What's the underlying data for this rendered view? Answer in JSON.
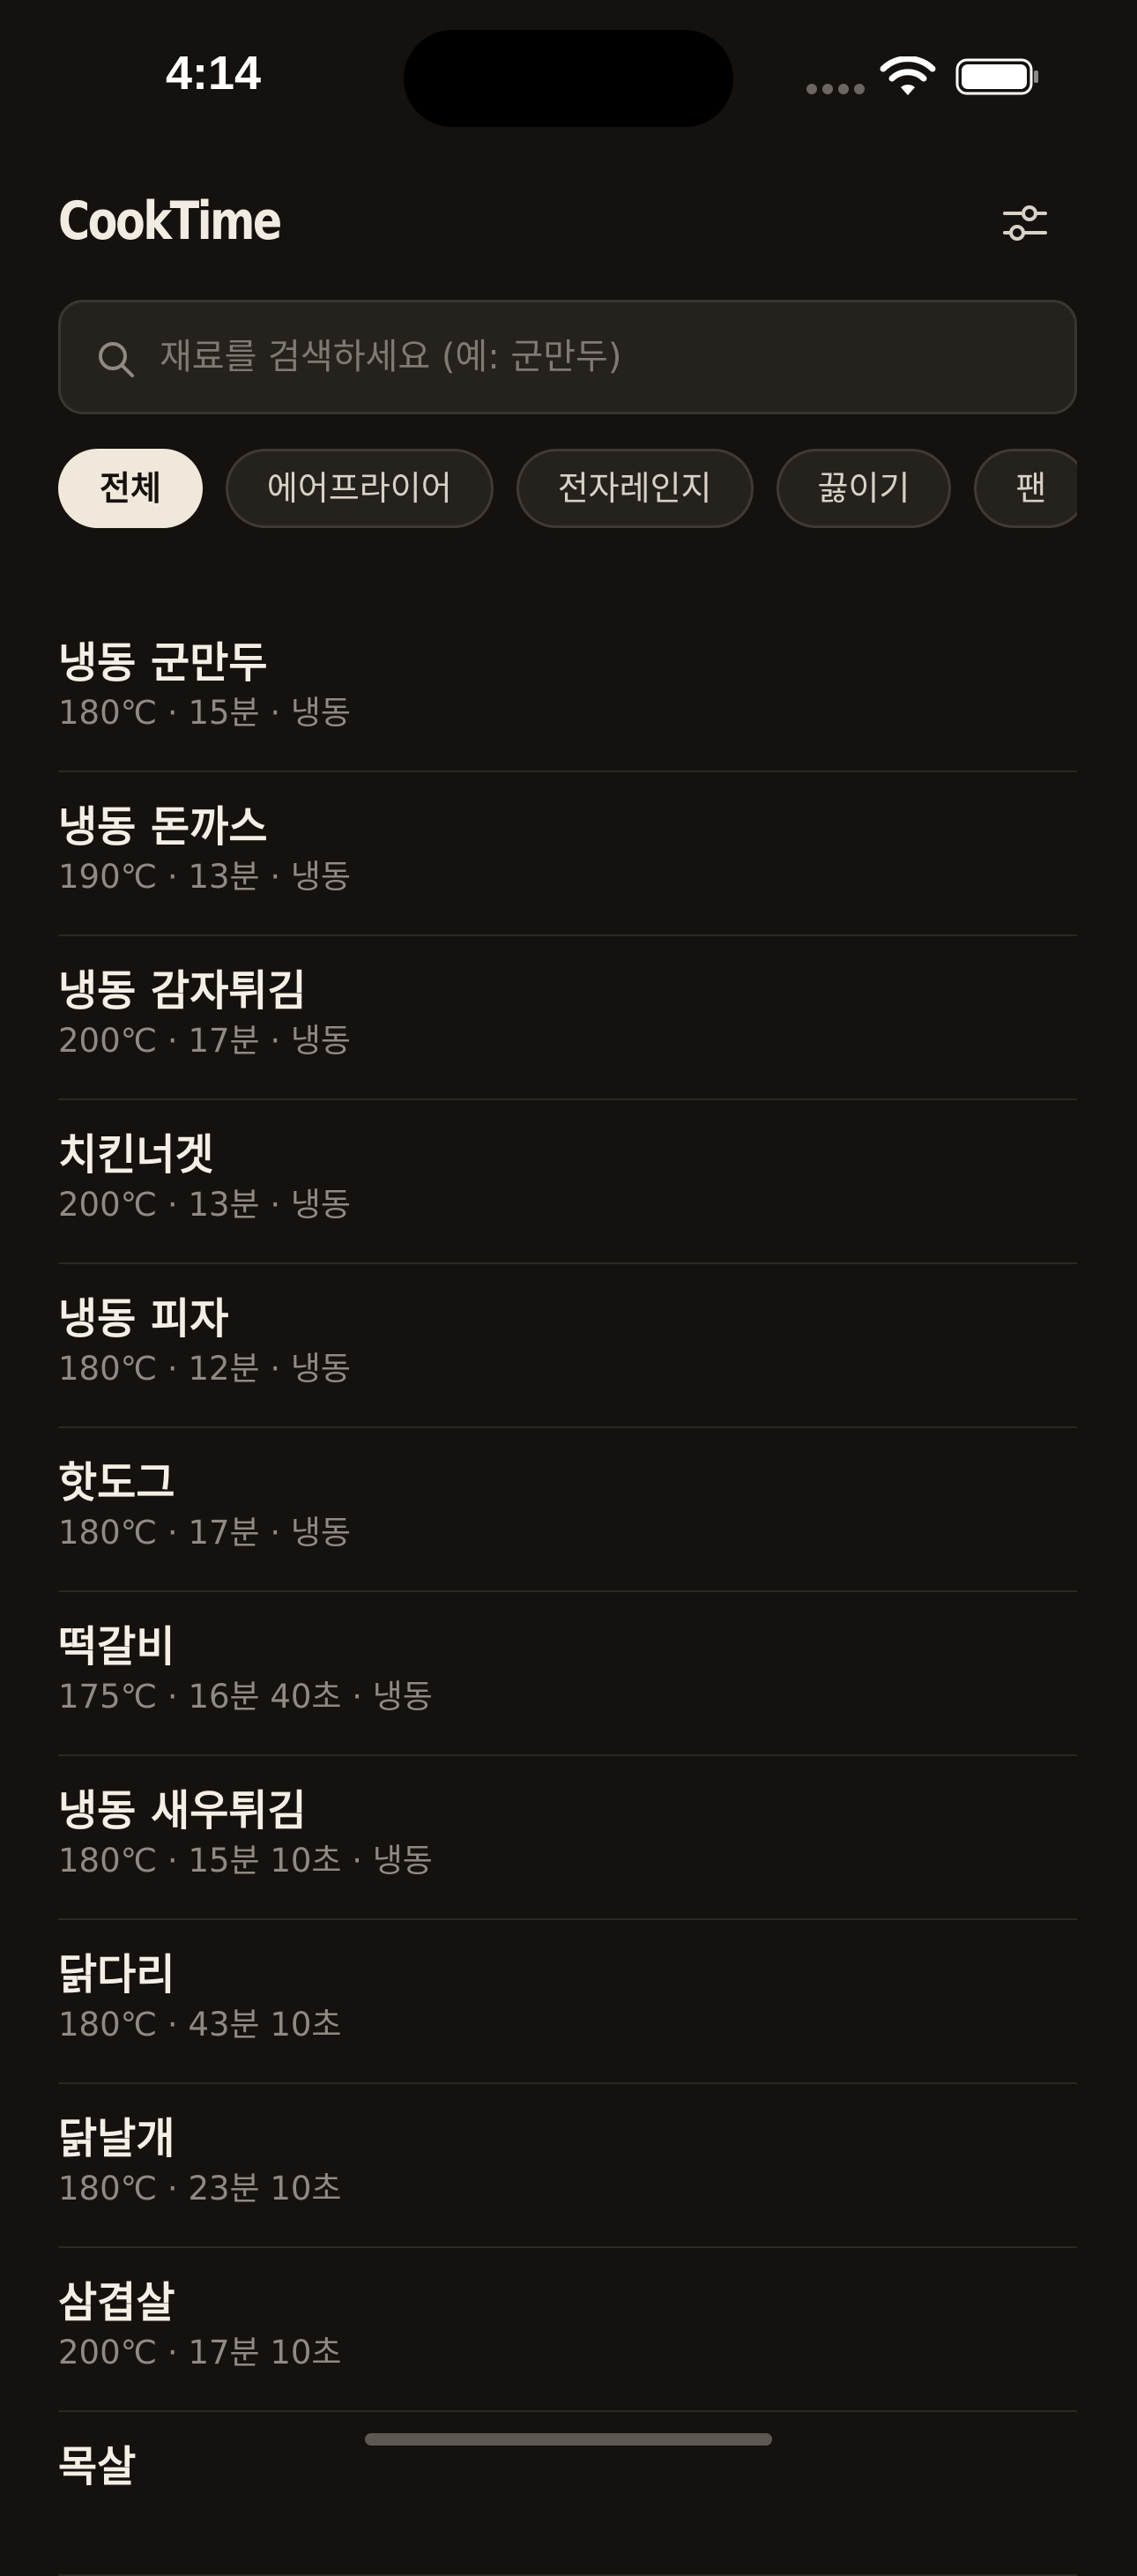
{
  "status_bar": {
    "time": "4:14"
  },
  "header": {
    "title": "CookTime",
    "filter_icon": "sliders-icon"
  },
  "search": {
    "placeholder": "재료를 검색하세요 (예: 군만두)",
    "value": "",
    "icon": "search-icon"
  },
  "categories": [
    {
      "label": "전체",
      "active": true
    },
    {
      "label": "에어프라이어",
      "active": false
    },
    {
      "label": "전자레인지",
      "active": false
    },
    {
      "label": "끓이기",
      "active": false
    },
    {
      "label": "팬",
      "active": false
    }
  ],
  "items": [
    {
      "name": "냉동 군만두",
      "meta": "180℃ · 15분 · 냉동"
    },
    {
      "name": "냉동 돈까스",
      "meta": "190℃ · 13분 · 냉동"
    },
    {
      "name": "냉동 감자튀김",
      "meta": "200℃ · 17분 · 냉동"
    },
    {
      "name": "치킨너겟",
      "meta": "200℃ · 13분 · 냉동"
    },
    {
      "name": "냉동 피자",
      "meta": "180℃ · 12분 · 냉동"
    },
    {
      "name": "핫도그",
      "meta": "180℃ · 17분 · 냉동"
    },
    {
      "name": "떡갈비",
      "meta": "175℃ · 16분 40초 · 냉동"
    },
    {
      "name": "냉동 새우튀김",
      "meta": "180℃ · 15분 10초 · 냉동"
    },
    {
      "name": "닭다리",
      "meta": "180℃ · 43분 10초"
    },
    {
      "name": "닭날개",
      "meta": "180℃ · 23분 10초"
    },
    {
      "name": "삼겹살",
      "meta": "200℃ · 17분 10초"
    },
    {
      "name": "목살",
      "meta": ""
    }
  ],
  "colors": {
    "background": "#14110e",
    "accent_chip": "#f0e8da",
    "text_primary": "#f4eee4",
    "text_secondary": "#8f8a82"
  }
}
